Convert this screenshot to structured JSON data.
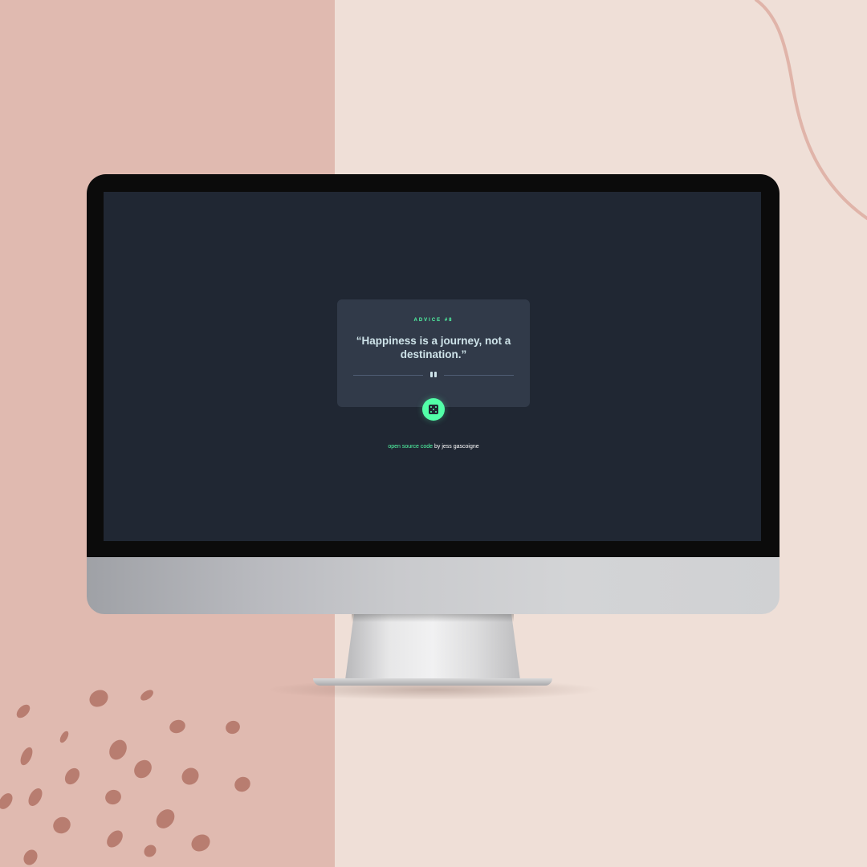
{
  "app": {
    "advice_label": "ADVICE #8",
    "quote": "“Happiness is a journey, not a destination.”",
    "attribution": {
      "link_text": "open source code",
      "rest_text": " by jess gascoigne"
    }
  },
  "icons": {
    "divider": "pause-icon",
    "button": "dice-icon"
  },
  "colors": {
    "accent": "#52ffa8",
    "screen_bg": "#202733",
    "card_bg": "#313a49",
    "text_light": "#cee3e9",
    "bg_left": "#e0bab0",
    "bg_right": "#efdfd7"
  }
}
